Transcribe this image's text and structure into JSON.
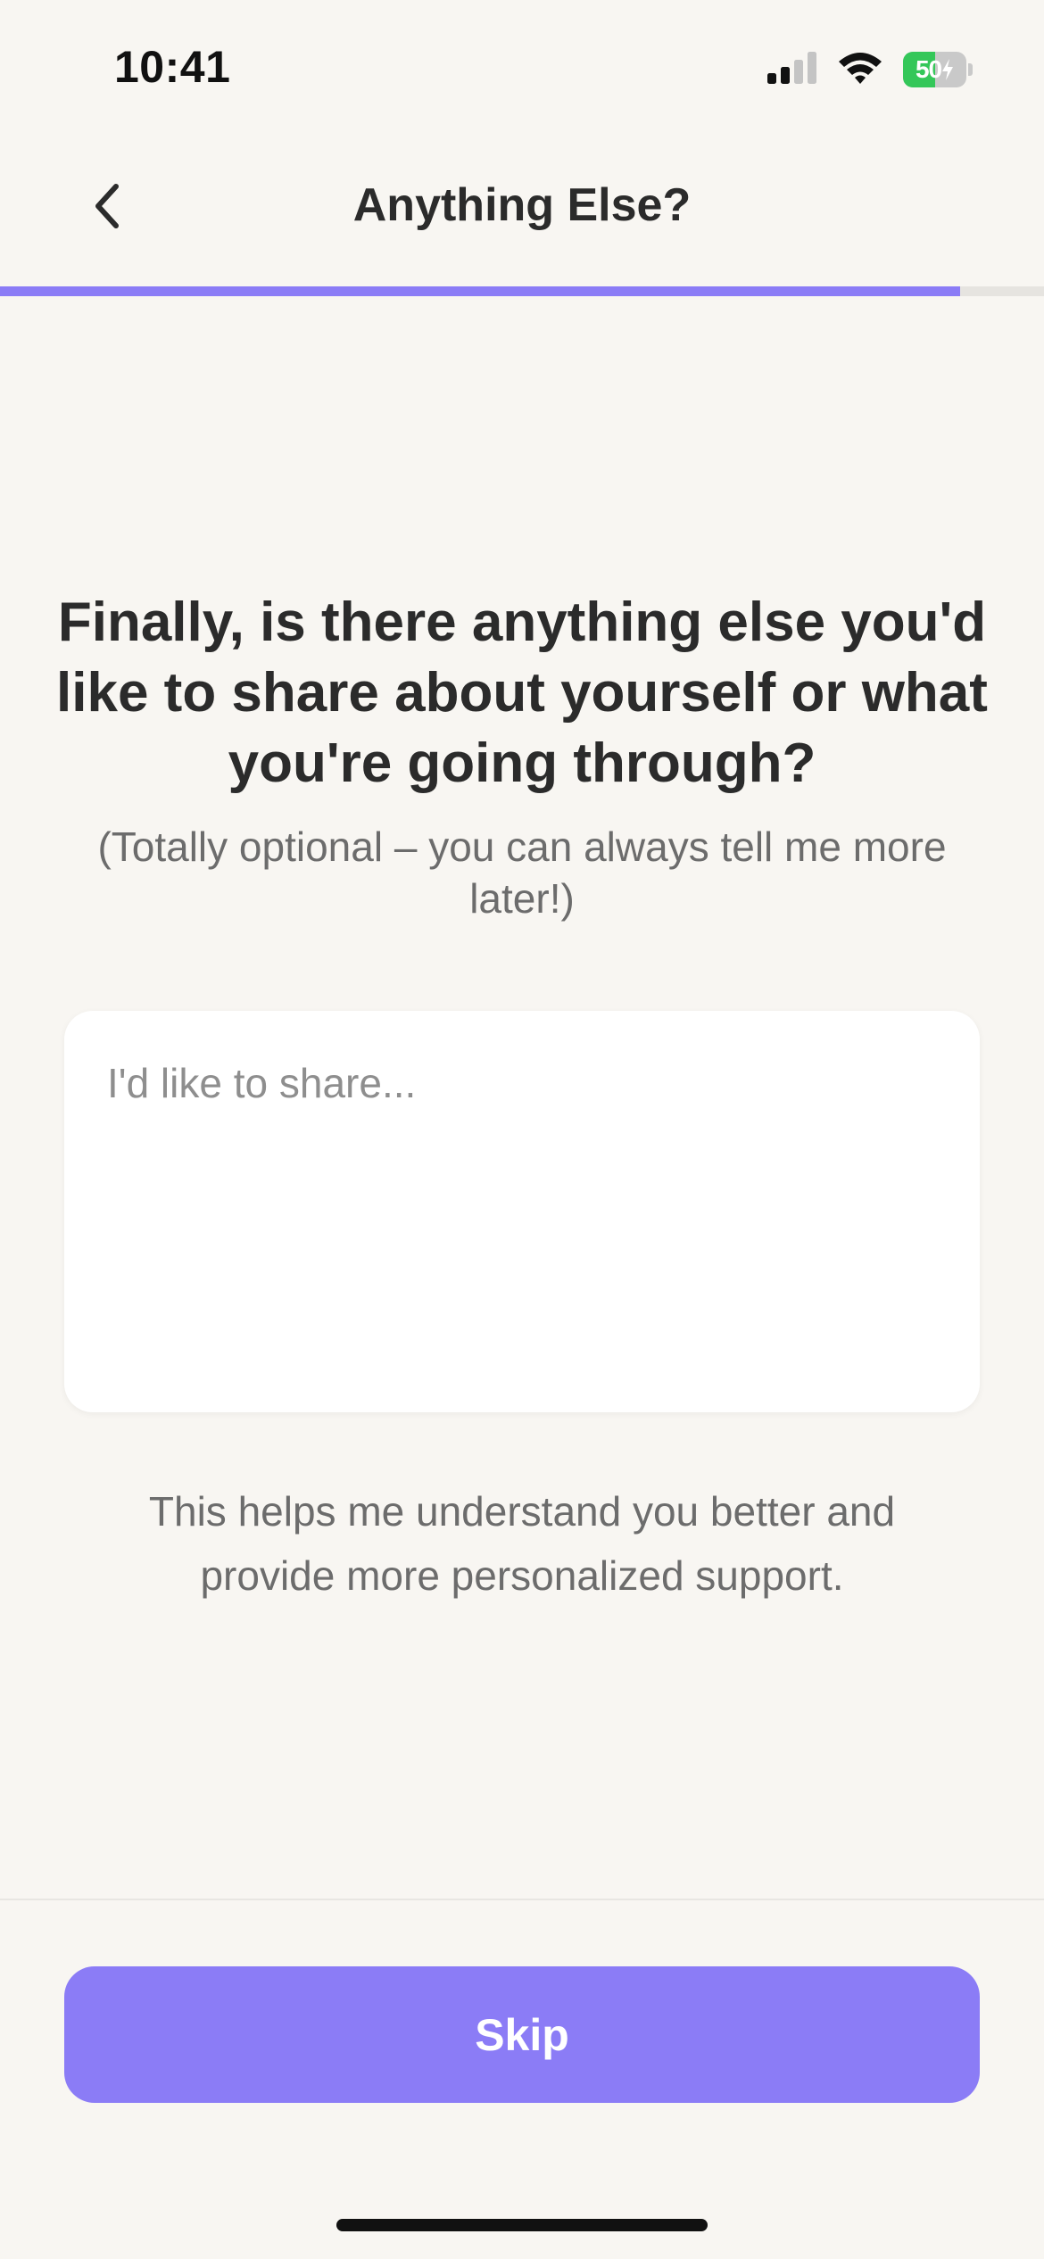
{
  "status_bar": {
    "time": "10:41",
    "battery_level": "50",
    "battery_fraction": 0.5,
    "battery_charging": true,
    "icons": [
      "cellular-signal-icon",
      "wifi-icon",
      "battery-charging-icon"
    ]
  },
  "nav": {
    "title": "Anything Else?",
    "back_icon": "chevron-left-icon"
  },
  "progress": {
    "fraction": 0.92
  },
  "question": {
    "title": "Finally, is there anything else you'd like to share about yourself or what you're going through?",
    "subtitle": "(Totally optional – you can always tell me more later!)"
  },
  "share_input": {
    "value": "",
    "placeholder": "I'd like to share..."
  },
  "helper_text": "This helps me understand you better and provide more personalized support.",
  "footer": {
    "skip_label": "Skip"
  },
  "colors": {
    "accent": "#8b7cf6",
    "background": "#f8f6f2",
    "battery_green": "#34c759"
  }
}
